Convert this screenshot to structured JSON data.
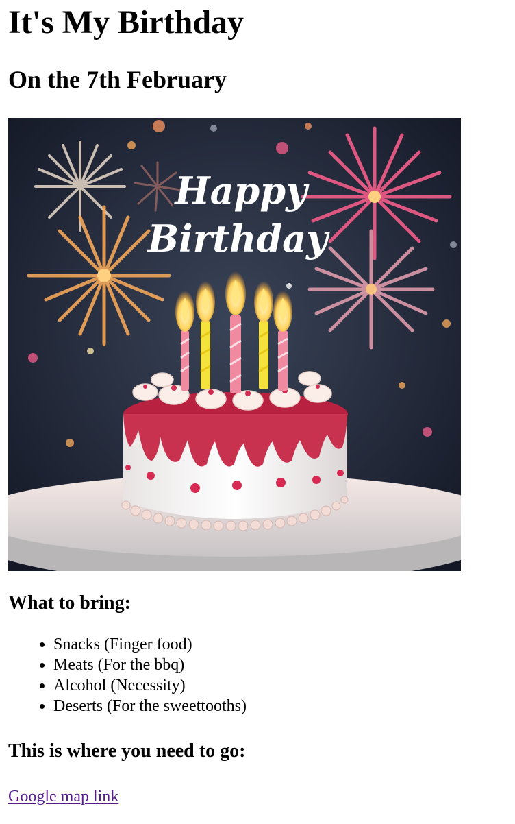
{
  "page": {
    "title": "It's My Birthday",
    "subtitle": "On the 7th February"
  },
  "hero_image": {
    "alt": "Birthday cake with candles and fireworks",
    "overlay_text_line1": "Happy",
    "overlay_text_line2": "Birthday",
    "colors": {
      "background": "#23293a",
      "firework_pink": "#e85a85",
      "firework_orange": "#f2a65a",
      "frosting": "#c8324f",
      "cake": "#f6f1ef",
      "candle_yellow": "#f5e23c",
      "candle_pink": "#f08aa0"
    }
  },
  "bring_section": {
    "heading": "What to bring:",
    "items": [
      "Snacks (Finger food)",
      "Meats (For the bbq)",
      "Alcohol (Necessity)",
      "Deserts (For the sweettooths)"
    ]
  },
  "location_section": {
    "heading": "This is where you need to go:",
    "link_label": "Google map link",
    "link_color": "#551a8b"
  }
}
